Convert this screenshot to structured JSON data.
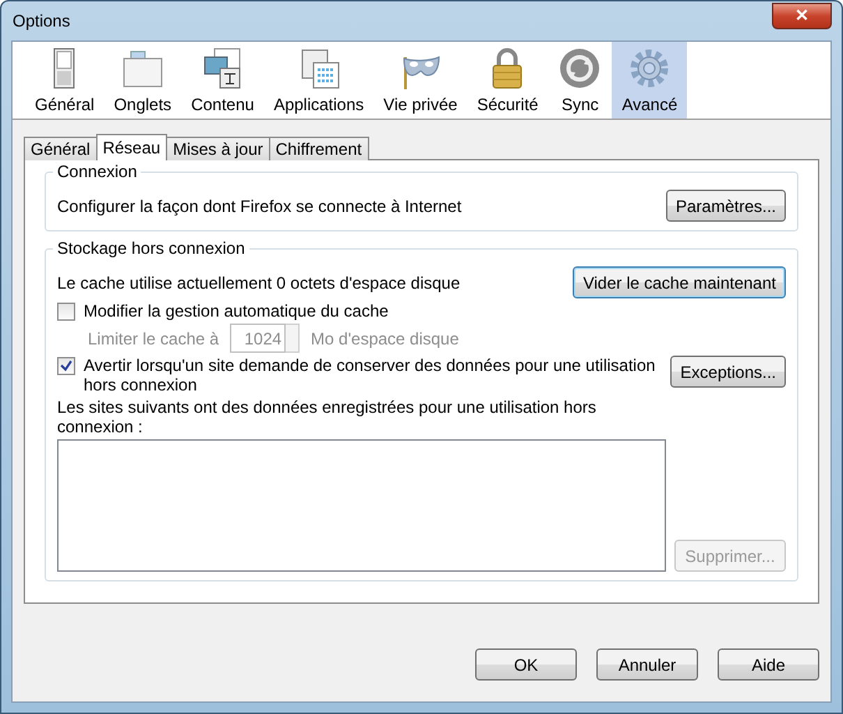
{
  "window": {
    "title": "Options",
    "close": "✕"
  },
  "toolbar": [
    {
      "kind": "general",
      "label": "Général",
      "selected": false
    },
    {
      "kind": "tabs",
      "label": "Onglets",
      "selected": false
    },
    {
      "kind": "content",
      "label": "Contenu",
      "selected": false
    },
    {
      "kind": "applications",
      "label": "Applications",
      "selected": false
    },
    {
      "kind": "privacy",
      "label": "Vie privée",
      "selected": false
    },
    {
      "kind": "security",
      "label": "Sécurité",
      "selected": false
    },
    {
      "kind": "sync",
      "label": "Sync",
      "selected": false
    },
    {
      "kind": "advanced",
      "label": "Avancé",
      "selected": true
    }
  ],
  "tabs": [
    {
      "label": "Général",
      "selected": false
    },
    {
      "label": "Réseau",
      "selected": true
    },
    {
      "label": "Mises à jour",
      "selected": false
    },
    {
      "label": "Chiffrement",
      "selected": false
    }
  ],
  "connection": {
    "title": "Connexion",
    "text": "Configurer la façon dont Firefox se connecte à Internet",
    "button": "Paramètres..."
  },
  "offline": {
    "title": "Stockage hors connexion",
    "cache_text": "Le cache utilise actuellement 0 octets d'espace disque",
    "clear_button": "Vider le cache maintenant",
    "override": {
      "label": "Modifier la gestion automatique du cache",
      "checked": false
    },
    "limit": {
      "label": "Limiter le cache à",
      "value": "1024",
      "unit": "Mo d'espace disque",
      "disabled": true
    },
    "warn": {
      "label": "Avertir lorsqu'un site demande de conserver des données pour une utilisation hors connexion",
      "checked": true
    },
    "exceptions_button": "Exceptions...",
    "sites_label": "Les sites suivants ont des données enregistrées pour une utilisation hors connexion :",
    "remove_button": {
      "label": "Supprimer...",
      "disabled": true
    }
  },
  "buttons": [
    "OK",
    "Annuler",
    "Aide"
  ]
}
